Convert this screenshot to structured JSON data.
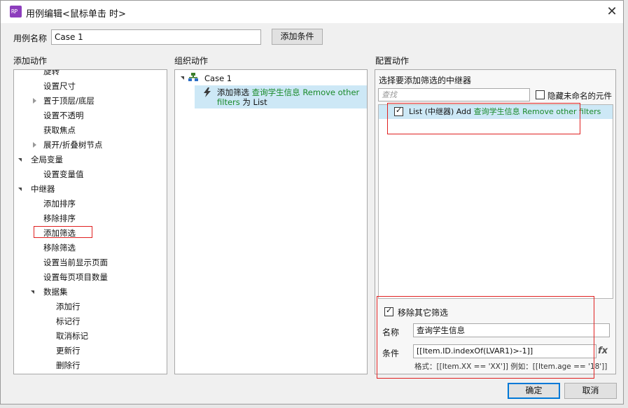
{
  "window": {
    "title": "用例编辑<鼠标单击 时>",
    "app_icon_text": "RP",
    "close_glyph": "✕"
  },
  "case_name": {
    "label": "用例名称",
    "value": "Case 1",
    "add_condition_button": "添加条件"
  },
  "sections": {
    "add_action": "添加动作",
    "organize_action": "组织动作",
    "configure_action": "配置动作"
  },
  "action_tree": {
    "items": [
      {
        "label": "旋转",
        "indent": 2
      },
      {
        "label": "设置尺寸",
        "indent": 2
      },
      {
        "label": "置于顶层/底层",
        "indent": 2,
        "expander": "closed"
      },
      {
        "label": "设置不透明",
        "indent": 2
      },
      {
        "label": "获取焦点",
        "indent": 2
      },
      {
        "label": "展开/折叠树节点",
        "indent": 2,
        "expander": "closed"
      },
      {
        "label": "全局变量",
        "indent": 1,
        "expander": "open"
      },
      {
        "label": "设置变量值",
        "indent": 2
      },
      {
        "label": "中继器",
        "indent": 1,
        "expander": "open"
      },
      {
        "label": "添加排序",
        "indent": 2
      },
      {
        "label": "移除排序",
        "indent": 2
      },
      {
        "label": "添加筛选",
        "indent": 2,
        "boxed": true
      },
      {
        "label": "移除筛选",
        "indent": 2
      },
      {
        "label": "设置当前显示页面",
        "indent": 2
      },
      {
        "label": "设置每页项目数量",
        "indent": 2
      },
      {
        "label": "数据集",
        "indent": 2,
        "expander": "open"
      },
      {
        "label": "添加行",
        "indent": 3
      },
      {
        "label": "标记行",
        "indent": 3
      },
      {
        "label": "取消标记",
        "indent": 3
      },
      {
        "label": "更新行",
        "indent": 3
      },
      {
        "label": "删除行",
        "indent": 3
      }
    ]
  },
  "organize": {
    "case_label": "Case 1",
    "action_prefix": "添加筛选",
    "action_target": "查询学生信息",
    "action_mid": "Remove other",
    "action_line2_green": "filters",
    "action_line2_tail": "为 List"
  },
  "configure": {
    "select_repeater_label": "选择要添加筛选的中继器",
    "search_placeholder": "查找",
    "hide_unnamed_label": "隐藏未命名的元件",
    "hide_unnamed_checked": false,
    "repeater_item": {
      "checked": true,
      "prefix": "List (中继器) Add",
      "green": "查询学生信息 Remove other filters"
    },
    "remove_other_filters": {
      "label": "移除其它筛选",
      "checked": true
    },
    "name": {
      "label": "名称",
      "value": "查询学生信息"
    },
    "condition": {
      "label": "条件",
      "value": "[[Item.ID.indexOf(LVAR1)>-1]]",
      "fx": "fx"
    },
    "format_hint": "格式：[[Item.XX == 'XX']] 例如：[[Item.age == '18']]"
  },
  "footer": {
    "ok_button": "确定",
    "cancel_button": "取消"
  },
  "colors": {
    "accent_blue": "#0078d7",
    "highlight": "#cde8f6",
    "red_annotation": "#e02020",
    "green_text": "#1a8a2a",
    "rp_icon": "#8d3dbd"
  }
}
